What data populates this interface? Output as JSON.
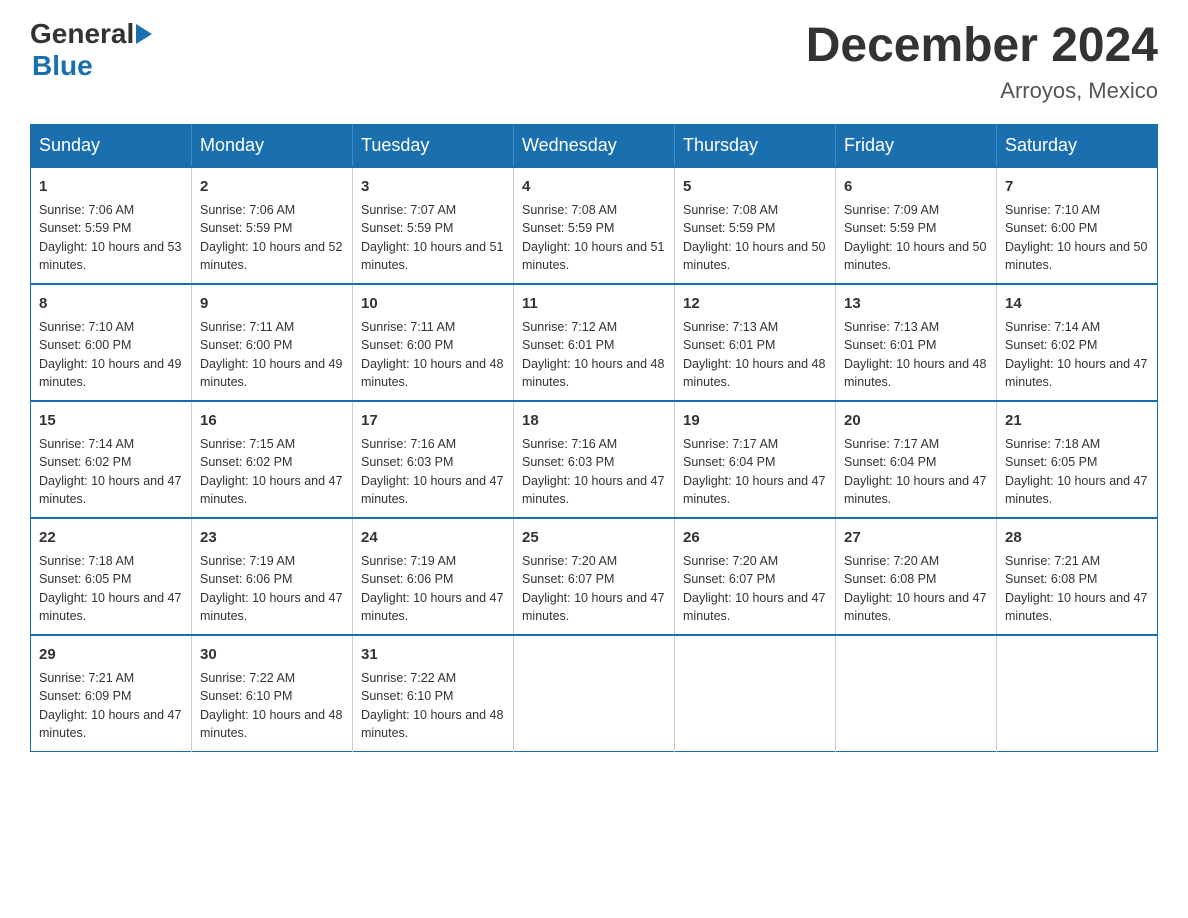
{
  "logo": {
    "general": "General",
    "blue": "Blue"
  },
  "title": "December 2024",
  "subtitle": "Arroyos, Mexico",
  "days_of_week": [
    "Sunday",
    "Monday",
    "Tuesday",
    "Wednesday",
    "Thursday",
    "Friday",
    "Saturday"
  ],
  "weeks": [
    [
      {
        "day": "1",
        "sunrise": "7:06 AM",
        "sunset": "5:59 PM",
        "daylight": "10 hours and 53 minutes."
      },
      {
        "day": "2",
        "sunrise": "7:06 AM",
        "sunset": "5:59 PM",
        "daylight": "10 hours and 52 minutes."
      },
      {
        "day": "3",
        "sunrise": "7:07 AM",
        "sunset": "5:59 PM",
        "daylight": "10 hours and 51 minutes."
      },
      {
        "day": "4",
        "sunrise": "7:08 AM",
        "sunset": "5:59 PM",
        "daylight": "10 hours and 51 minutes."
      },
      {
        "day": "5",
        "sunrise": "7:08 AM",
        "sunset": "5:59 PM",
        "daylight": "10 hours and 50 minutes."
      },
      {
        "day": "6",
        "sunrise": "7:09 AM",
        "sunset": "5:59 PM",
        "daylight": "10 hours and 50 minutes."
      },
      {
        "day": "7",
        "sunrise": "7:10 AM",
        "sunset": "6:00 PM",
        "daylight": "10 hours and 50 minutes."
      }
    ],
    [
      {
        "day": "8",
        "sunrise": "7:10 AM",
        "sunset": "6:00 PM",
        "daylight": "10 hours and 49 minutes."
      },
      {
        "day": "9",
        "sunrise": "7:11 AM",
        "sunset": "6:00 PM",
        "daylight": "10 hours and 49 minutes."
      },
      {
        "day": "10",
        "sunrise": "7:11 AM",
        "sunset": "6:00 PM",
        "daylight": "10 hours and 48 minutes."
      },
      {
        "day": "11",
        "sunrise": "7:12 AM",
        "sunset": "6:01 PM",
        "daylight": "10 hours and 48 minutes."
      },
      {
        "day": "12",
        "sunrise": "7:13 AM",
        "sunset": "6:01 PM",
        "daylight": "10 hours and 48 minutes."
      },
      {
        "day": "13",
        "sunrise": "7:13 AM",
        "sunset": "6:01 PM",
        "daylight": "10 hours and 48 minutes."
      },
      {
        "day": "14",
        "sunrise": "7:14 AM",
        "sunset": "6:02 PM",
        "daylight": "10 hours and 47 minutes."
      }
    ],
    [
      {
        "day": "15",
        "sunrise": "7:14 AM",
        "sunset": "6:02 PM",
        "daylight": "10 hours and 47 minutes."
      },
      {
        "day": "16",
        "sunrise": "7:15 AM",
        "sunset": "6:02 PM",
        "daylight": "10 hours and 47 minutes."
      },
      {
        "day": "17",
        "sunrise": "7:16 AM",
        "sunset": "6:03 PM",
        "daylight": "10 hours and 47 minutes."
      },
      {
        "day": "18",
        "sunrise": "7:16 AM",
        "sunset": "6:03 PM",
        "daylight": "10 hours and 47 minutes."
      },
      {
        "day": "19",
        "sunrise": "7:17 AM",
        "sunset": "6:04 PM",
        "daylight": "10 hours and 47 minutes."
      },
      {
        "day": "20",
        "sunrise": "7:17 AM",
        "sunset": "6:04 PM",
        "daylight": "10 hours and 47 minutes."
      },
      {
        "day": "21",
        "sunrise": "7:18 AM",
        "sunset": "6:05 PM",
        "daylight": "10 hours and 47 minutes."
      }
    ],
    [
      {
        "day": "22",
        "sunrise": "7:18 AM",
        "sunset": "6:05 PM",
        "daylight": "10 hours and 47 minutes."
      },
      {
        "day": "23",
        "sunrise": "7:19 AM",
        "sunset": "6:06 PM",
        "daylight": "10 hours and 47 minutes."
      },
      {
        "day": "24",
        "sunrise": "7:19 AM",
        "sunset": "6:06 PM",
        "daylight": "10 hours and 47 minutes."
      },
      {
        "day": "25",
        "sunrise": "7:20 AM",
        "sunset": "6:07 PM",
        "daylight": "10 hours and 47 minutes."
      },
      {
        "day": "26",
        "sunrise": "7:20 AM",
        "sunset": "6:07 PM",
        "daylight": "10 hours and 47 minutes."
      },
      {
        "day": "27",
        "sunrise": "7:20 AM",
        "sunset": "6:08 PM",
        "daylight": "10 hours and 47 minutes."
      },
      {
        "day": "28",
        "sunrise": "7:21 AM",
        "sunset": "6:08 PM",
        "daylight": "10 hours and 47 minutes."
      }
    ],
    [
      {
        "day": "29",
        "sunrise": "7:21 AM",
        "sunset": "6:09 PM",
        "daylight": "10 hours and 47 minutes."
      },
      {
        "day": "30",
        "sunrise": "7:22 AM",
        "sunset": "6:10 PM",
        "daylight": "10 hours and 48 minutes."
      },
      {
        "day": "31",
        "sunrise": "7:22 AM",
        "sunset": "6:10 PM",
        "daylight": "10 hours and 48 minutes."
      },
      null,
      null,
      null,
      null
    ]
  ]
}
